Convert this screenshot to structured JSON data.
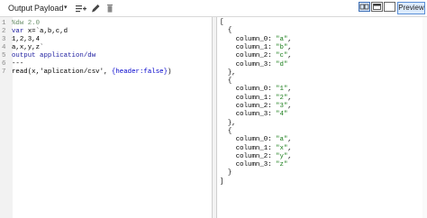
{
  "toolbar": {
    "output_label": "Output",
    "payload_label": "Payload",
    "caret": "▾",
    "preview_label": "Preview"
  },
  "colors": {
    "keyword": "#1a1a9e",
    "string": "#1a7d1a",
    "json_key": "#a81a1a",
    "accent": "#5b8fd6"
  },
  "editor": {
    "lines": [
      {
        "num": "1",
        "parts": [
          {
            "t": "%dw 2.0",
            "c": "cmt"
          }
        ]
      },
      {
        "num": "2",
        "parts": [
          {
            "t": "var ",
            "c": "kw"
          },
          {
            "t": "x=`a,b,c,d",
            "c": "code"
          }
        ]
      },
      {
        "num": "3",
        "parts": [
          {
            "t": "1,2,3,4",
            "c": "code"
          }
        ]
      },
      {
        "num": "4",
        "parts": [
          {
            "t": "a,x,y,z`",
            "c": "code"
          }
        ]
      },
      {
        "num": "5",
        "parts": [
          {
            "t": "output application/dw",
            "c": "kw"
          }
        ]
      },
      {
        "num": "6",
        "parts": [
          {
            "t": "---",
            "c": "code"
          }
        ]
      },
      {
        "num": "7",
        "parts": [
          {
            "t": "read",
            "c": "code"
          },
          {
            "t": "(x,",
            "c": "code"
          },
          {
            "t": "'aplication/csv'",
            "c": "code"
          },
          {
            "t": ", ",
            "c": "code"
          },
          {
            "t": "{header:false}",
            "c": "fn"
          },
          {
            "t": ")",
            "c": "code"
          }
        ]
      }
    ]
  },
  "output": {
    "lines": [
      {
        "parts": [
          {
            "t": "[",
            "c": ""
          }
        ]
      },
      {
        "parts": [
          {
            "t": "  {",
            "c": ""
          }
        ]
      },
      {
        "parts": [
          {
            "t": "    column_0: ",
            "c": ""
          },
          {
            "t": "\"a\"",
            "c": "s"
          },
          {
            "t": ",",
            "c": ""
          }
        ]
      },
      {
        "parts": [
          {
            "t": "    column_1: ",
            "c": ""
          },
          {
            "t": "\"b\"",
            "c": "s"
          },
          {
            "t": ",",
            "c": ""
          }
        ]
      },
      {
        "parts": [
          {
            "t": "    column_2: ",
            "c": ""
          },
          {
            "t": "\"c\"",
            "c": "s"
          },
          {
            "t": ",",
            "c": ""
          }
        ]
      },
      {
        "parts": [
          {
            "t": "    column_3: ",
            "c": ""
          },
          {
            "t": "\"d\"",
            "c": "s"
          }
        ]
      },
      {
        "parts": [
          {
            "t": "  },",
            "c": ""
          }
        ]
      },
      {
        "parts": [
          {
            "t": "  {",
            "c": ""
          }
        ]
      },
      {
        "parts": [
          {
            "t": "    column_0: ",
            "c": ""
          },
          {
            "t": "\"1\"",
            "c": "s"
          },
          {
            "t": ",",
            "c": ""
          }
        ]
      },
      {
        "parts": [
          {
            "t": "    column_1: ",
            "c": ""
          },
          {
            "t": "\"2\"",
            "c": "s"
          },
          {
            "t": ",",
            "c": ""
          }
        ]
      },
      {
        "parts": [
          {
            "t": "    column_2: ",
            "c": ""
          },
          {
            "t": "\"3\"",
            "c": "s"
          },
          {
            "t": ",",
            "c": ""
          }
        ]
      },
      {
        "parts": [
          {
            "t": "    column_3: ",
            "c": ""
          },
          {
            "t": "\"4\"",
            "c": "s"
          }
        ]
      },
      {
        "parts": [
          {
            "t": "  },",
            "c": ""
          }
        ]
      },
      {
        "parts": [
          {
            "t": "  {",
            "c": ""
          }
        ]
      },
      {
        "parts": [
          {
            "t": "    column_0: ",
            "c": ""
          },
          {
            "t": "\"a\"",
            "c": "s"
          },
          {
            "t": ",",
            "c": ""
          }
        ]
      },
      {
        "parts": [
          {
            "t": "    column_1: ",
            "c": ""
          },
          {
            "t": "\"x\"",
            "c": "s"
          },
          {
            "t": ",",
            "c": ""
          }
        ]
      },
      {
        "parts": [
          {
            "t": "    column_2: ",
            "c": ""
          },
          {
            "t": "\"y\"",
            "c": "s"
          },
          {
            "t": ",",
            "c": ""
          }
        ]
      },
      {
        "parts": [
          {
            "t": "    column_3: ",
            "c": ""
          },
          {
            "t": "\"z\"",
            "c": "s"
          }
        ]
      },
      {
        "parts": [
          {
            "t": "  }",
            "c": ""
          }
        ]
      },
      {
        "parts": [
          {
            "t": "]",
            "c": ""
          }
        ]
      }
    ]
  },
  "icons": [
    "add-list-icon",
    "pencil-icon",
    "trash-icon",
    "split-view-icon",
    "single-view-icon",
    "blank-view-icon"
  ]
}
